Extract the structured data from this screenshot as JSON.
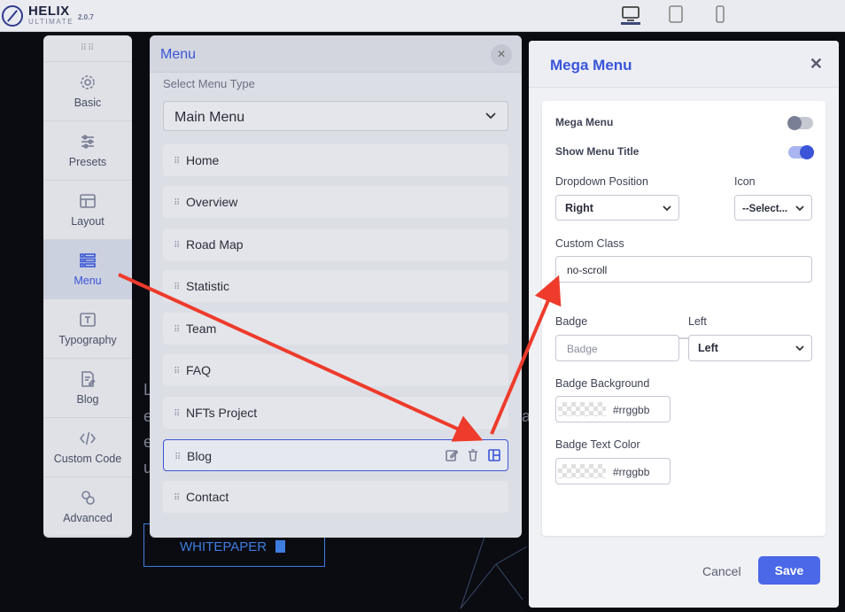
{
  "app": {
    "name": "HELIX",
    "subtitle": "ULTIMATE",
    "version": "2.0.7",
    "devices": [
      "desktop-icon",
      "tablet-icon",
      "mobile-icon"
    ]
  },
  "background": {
    "letters": [
      "L",
      "e",
      "e",
      "u"
    ],
    "right_letter": "a",
    "whitepaper_label": "WHITEPAPER"
  },
  "sidebar": {
    "items": [
      {
        "label": "Basic",
        "icon": "gear-icon"
      },
      {
        "label": "Presets",
        "icon": "sliders-icon"
      },
      {
        "label": "Layout",
        "icon": "layout-icon"
      },
      {
        "label": "Menu",
        "icon": "menu-list-icon",
        "active": true
      },
      {
        "label": "Typography",
        "icon": "typography-icon"
      },
      {
        "label": "Blog",
        "icon": "blog-icon"
      },
      {
        "label": "Custom Code",
        "icon": "code-icon"
      },
      {
        "label": "Advanced",
        "icon": "advanced-icon"
      }
    ]
  },
  "menu_panel": {
    "title": "Menu",
    "select_label": "Select Menu Type",
    "selected_menu": "Main Menu",
    "items": [
      "Home",
      "Overview",
      "Road Map",
      "Statistic",
      "Team",
      "FAQ",
      "NFTs Project",
      "Blog",
      "Contact"
    ],
    "active_item": "Blog"
  },
  "mega_panel": {
    "title": "Mega Menu",
    "mega_menu_label": "Mega Menu",
    "mega_menu_enabled": false,
    "show_title_label": "Show Menu Title",
    "show_title_enabled": true,
    "dropdown_position_label": "Dropdown Position",
    "dropdown_position_value": "Right",
    "icon_label": "Icon",
    "icon_value": "--Select...",
    "custom_class_label": "Custom Class",
    "custom_class_value": "no-scroll",
    "badge_label": "Badge",
    "badge_placeholder": "Badge",
    "badge_side_label": "Left",
    "badge_side_value": "Left",
    "badge_bg_label": "Badge Background",
    "badge_bg_value": "#rrggbb",
    "badge_text_label": "Badge Text Color",
    "badge_text_value": "#rrggbb",
    "cancel_label": "Cancel",
    "save_label": "Save"
  },
  "colors": {
    "accent": "#3a55d8",
    "annotation_arrow": "#ee3b2b"
  }
}
